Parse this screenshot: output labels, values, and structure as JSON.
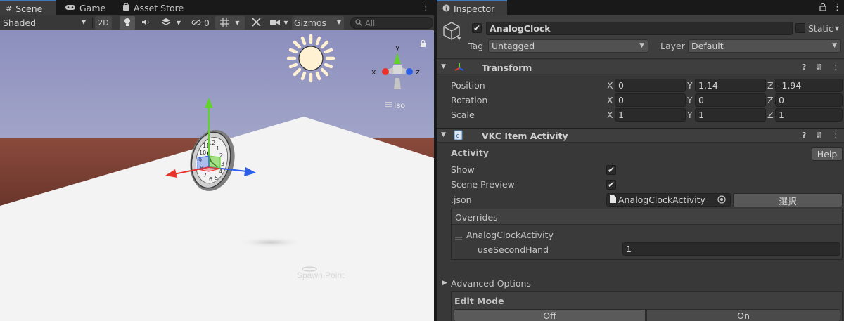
{
  "scene_view": {
    "tabs": [
      {
        "label": "Scene",
        "icon": "hash-icon"
      },
      {
        "label": "Game",
        "icon": "gamepad-icon"
      },
      {
        "label": "Asset Store",
        "icon": "shopping-bag-icon"
      }
    ],
    "toolbar": {
      "shading_mode": "Shaded",
      "toggle_2d": "2D",
      "hidden_count": "0",
      "gizmos_label": "Gizmos",
      "search_placeholder": "All"
    },
    "axis_gizmo": {
      "y": "y",
      "x": "x",
      "z": "z",
      "projection": "Iso"
    },
    "scene_label": "Spawn Point"
  },
  "inspector": {
    "tab_label": "Inspector",
    "object": {
      "name": "AnalogClock",
      "static_label": "Static",
      "tag_label": "Tag",
      "tag_value": "Untagged",
      "layer_label": "Layer",
      "layer_value": "Default"
    },
    "transform": {
      "title": "Transform",
      "rows": [
        {
          "label": "Position",
          "x": "0",
          "y": "1.14",
          "z": "-1.94"
        },
        {
          "label": "Rotation",
          "x": "0",
          "y": "0",
          "z": "0"
        },
        {
          "label": "Scale",
          "x": "1",
          "y": "1",
          "z": "1"
        }
      ],
      "axis_labels": {
        "x": "X",
        "y": "Y",
        "z": "Z"
      }
    },
    "vkc_item_activity": {
      "title": "VKC Item Activity",
      "section_label": "Activity",
      "help_label": "Help",
      "show_label": "Show",
      "scene_preview_label": "Scene Preview",
      "json_label": ".json",
      "json_value": "AnalogClockActivity",
      "select_label": "選択",
      "overrides_label": "Overrides",
      "override_name": "AnalogClockActivity",
      "override_param_label": "useSecondHand",
      "override_param_value": "1"
    },
    "advanced_options_label": "Advanced Options",
    "edit_mode": {
      "label": "Edit Mode",
      "off_label": "Off",
      "on_label": "On"
    }
  },
  "colors": {
    "accent": "#3a79bb",
    "sky": "#a3a6c9",
    "horizon": "#7d3e33",
    "ground": "#f4f4f4",
    "gizmo_x": "#e8322b",
    "gizmo_y": "#64d22d",
    "gizmo_z": "#2b5fe8"
  }
}
